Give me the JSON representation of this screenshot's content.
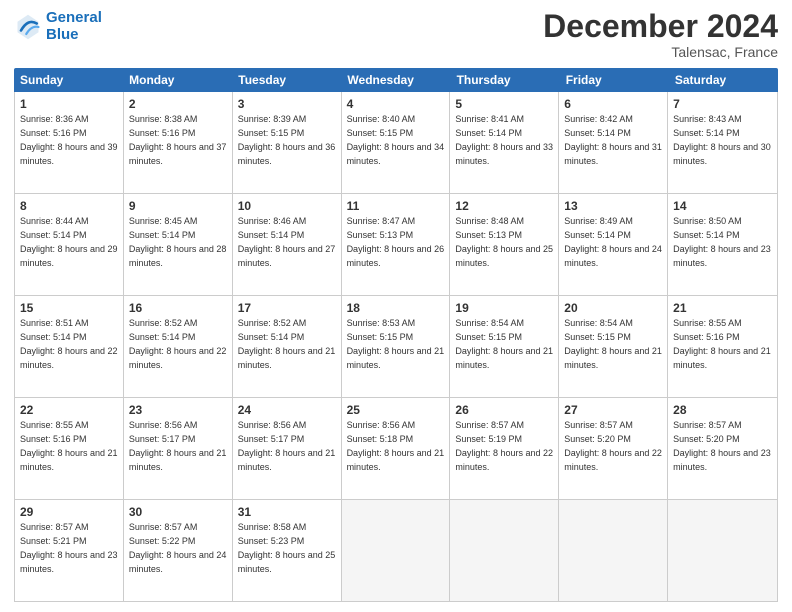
{
  "logo": {
    "line1": "General",
    "line2": "Blue"
  },
  "title": "December 2024",
  "location": "Talensac, France",
  "header_days": [
    "Sunday",
    "Monday",
    "Tuesday",
    "Wednesday",
    "Thursday",
    "Friday",
    "Saturday"
  ],
  "weeks": [
    [
      {
        "day": "1",
        "sunrise": "Sunrise: 8:36 AM",
        "sunset": "Sunset: 5:16 PM",
        "daylight": "Daylight: 8 hours and 39 minutes."
      },
      {
        "day": "2",
        "sunrise": "Sunrise: 8:38 AM",
        "sunset": "Sunset: 5:16 PM",
        "daylight": "Daylight: 8 hours and 37 minutes."
      },
      {
        "day": "3",
        "sunrise": "Sunrise: 8:39 AM",
        "sunset": "Sunset: 5:15 PM",
        "daylight": "Daylight: 8 hours and 36 minutes."
      },
      {
        "day": "4",
        "sunrise": "Sunrise: 8:40 AM",
        "sunset": "Sunset: 5:15 PM",
        "daylight": "Daylight: 8 hours and 34 minutes."
      },
      {
        "day": "5",
        "sunrise": "Sunrise: 8:41 AM",
        "sunset": "Sunset: 5:14 PM",
        "daylight": "Daylight: 8 hours and 33 minutes."
      },
      {
        "day": "6",
        "sunrise": "Sunrise: 8:42 AM",
        "sunset": "Sunset: 5:14 PM",
        "daylight": "Daylight: 8 hours and 31 minutes."
      },
      {
        "day": "7",
        "sunrise": "Sunrise: 8:43 AM",
        "sunset": "Sunset: 5:14 PM",
        "daylight": "Daylight: 8 hours and 30 minutes."
      }
    ],
    [
      {
        "day": "8",
        "sunrise": "Sunrise: 8:44 AM",
        "sunset": "Sunset: 5:14 PM",
        "daylight": "Daylight: 8 hours and 29 minutes."
      },
      {
        "day": "9",
        "sunrise": "Sunrise: 8:45 AM",
        "sunset": "Sunset: 5:14 PM",
        "daylight": "Daylight: 8 hours and 28 minutes."
      },
      {
        "day": "10",
        "sunrise": "Sunrise: 8:46 AM",
        "sunset": "Sunset: 5:14 PM",
        "daylight": "Daylight: 8 hours and 27 minutes."
      },
      {
        "day": "11",
        "sunrise": "Sunrise: 8:47 AM",
        "sunset": "Sunset: 5:13 PM",
        "daylight": "Daylight: 8 hours and 26 minutes."
      },
      {
        "day": "12",
        "sunrise": "Sunrise: 8:48 AM",
        "sunset": "Sunset: 5:13 PM",
        "daylight": "Daylight: 8 hours and 25 minutes."
      },
      {
        "day": "13",
        "sunrise": "Sunrise: 8:49 AM",
        "sunset": "Sunset: 5:14 PM",
        "daylight": "Daylight: 8 hours and 24 minutes."
      },
      {
        "day": "14",
        "sunrise": "Sunrise: 8:50 AM",
        "sunset": "Sunset: 5:14 PM",
        "daylight": "Daylight: 8 hours and 23 minutes."
      }
    ],
    [
      {
        "day": "15",
        "sunrise": "Sunrise: 8:51 AM",
        "sunset": "Sunset: 5:14 PM",
        "daylight": "Daylight: 8 hours and 22 minutes."
      },
      {
        "day": "16",
        "sunrise": "Sunrise: 8:52 AM",
        "sunset": "Sunset: 5:14 PM",
        "daylight": "Daylight: 8 hours and 22 minutes."
      },
      {
        "day": "17",
        "sunrise": "Sunrise: 8:52 AM",
        "sunset": "Sunset: 5:14 PM",
        "daylight": "Daylight: 8 hours and 21 minutes."
      },
      {
        "day": "18",
        "sunrise": "Sunrise: 8:53 AM",
        "sunset": "Sunset: 5:15 PM",
        "daylight": "Daylight: 8 hours and 21 minutes."
      },
      {
        "day": "19",
        "sunrise": "Sunrise: 8:54 AM",
        "sunset": "Sunset: 5:15 PM",
        "daylight": "Daylight: 8 hours and 21 minutes."
      },
      {
        "day": "20",
        "sunrise": "Sunrise: 8:54 AM",
        "sunset": "Sunset: 5:15 PM",
        "daylight": "Daylight: 8 hours and 21 minutes."
      },
      {
        "day": "21",
        "sunrise": "Sunrise: 8:55 AM",
        "sunset": "Sunset: 5:16 PM",
        "daylight": "Daylight: 8 hours and 21 minutes."
      }
    ],
    [
      {
        "day": "22",
        "sunrise": "Sunrise: 8:55 AM",
        "sunset": "Sunset: 5:16 PM",
        "daylight": "Daylight: 8 hours and 21 minutes."
      },
      {
        "day": "23",
        "sunrise": "Sunrise: 8:56 AM",
        "sunset": "Sunset: 5:17 PM",
        "daylight": "Daylight: 8 hours and 21 minutes."
      },
      {
        "day": "24",
        "sunrise": "Sunrise: 8:56 AM",
        "sunset": "Sunset: 5:17 PM",
        "daylight": "Daylight: 8 hours and 21 minutes."
      },
      {
        "day": "25",
        "sunrise": "Sunrise: 8:56 AM",
        "sunset": "Sunset: 5:18 PM",
        "daylight": "Daylight: 8 hours and 21 minutes."
      },
      {
        "day": "26",
        "sunrise": "Sunrise: 8:57 AM",
        "sunset": "Sunset: 5:19 PM",
        "daylight": "Daylight: 8 hours and 22 minutes."
      },
      {
        "day": "27",
        "sunrise": "Sunrise: 8:57 AM",
        "sunset": "Sunset: 5:20 PM",
        "daylight": "Daylight: 8 hours and 22 minutes."
      },
      {
        "day": "28",
        "sunrise": "Sunrise: 8:57 AM",
        "sunset": "Sunset: 5:20 PM",
        "daylight": "Daylight: 8 hours and 23 minutes."
      }
    ],
    [
      {
        "day": "29",
        "sunrise": "Sunrise: 8:57 AM",
        "sunset": "Sunset: 5:21 PM",
        "daylight": "Daylight: 8 hours and 23 minutes."
      },
      {
        "day": "30",
        "sunrise": "Sunrise: 8:57 AM",
        "sunset": "Sunset: 5:22 PM",
        "daylight": "Daylight: 8 hours and 24 minutes."
      },
      {
        "day": "31",
        "sunrise": "Sunrise: 8:58 AM",
        "sunset": "Sunset: 5:23 PM",
        "daylight": "Daylight: 8 hours and 25 minutes."
      },
      null,
      null,
      null,
      null
    ]
  ]
}
